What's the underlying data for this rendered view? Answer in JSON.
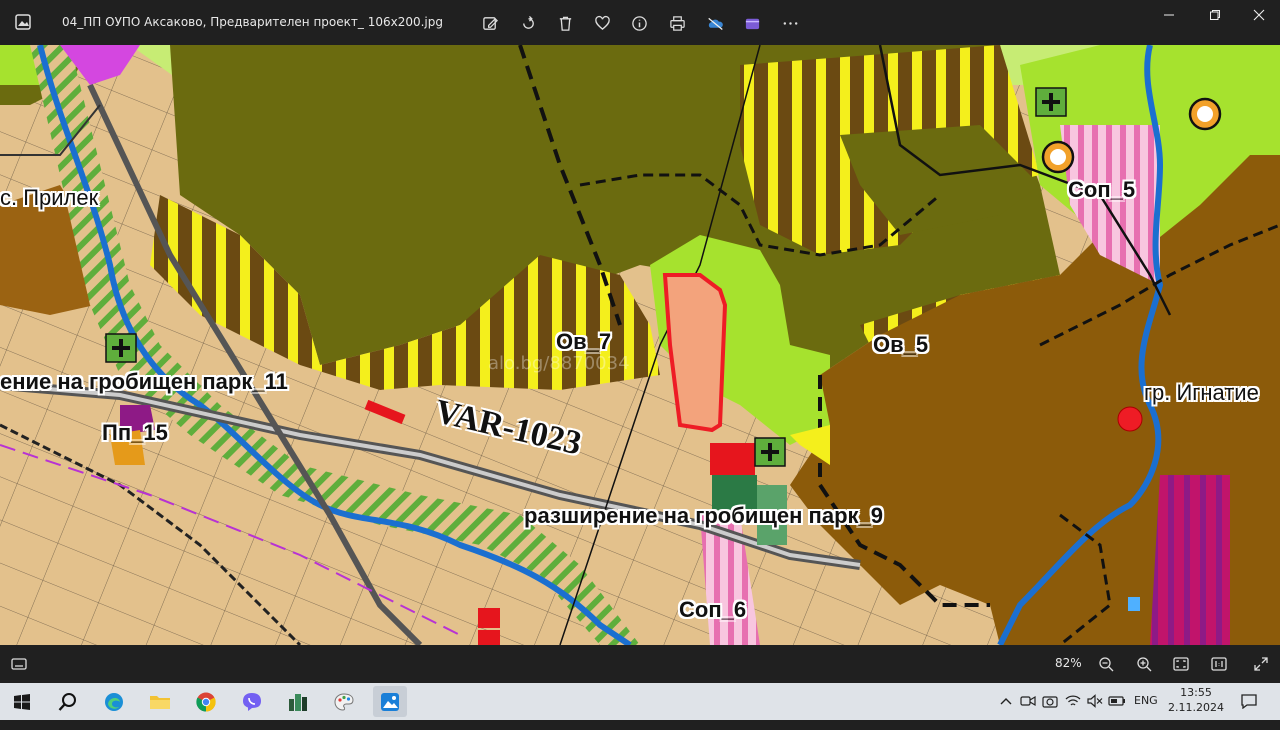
{
  "window": {
    "title": "04_ПП ОУПО Аксаково, Предварителен проект_ 106x200.jpg"
  },
  "toolbar": {
    "icons": [
      "edit-icon",
      "rotate-icon",
      "delete-icon",
      "favorite-icon",
      "info-icon",
      "print-icon",
      "onedrive-icon",
      "clipchamp-icon",
      "more-icon"
    ]
  },
  "map": {
    "labels": {
      "prilek": "с. Прилек",
      "ext11": "ение на гробищен парк_11",
      "pp15": "Пп_15",
      "ov7": "Ов_7",
      "ov5": "Ов_5",
      "sop5": "Соп_5",
      "ignatievo": "гр. Игнатие",
      "ext9": "разширение на гробищен парк_9",
      "sop6": "Соп_6",
      "road": "VAR-1023",
      "watermark": "alo.bg/8870034"
    }
  },
  "status": {
    "zoom": "82%"
  },
  "taskbar": {
    "lang": "ENG",
    "time": "13:55",
    "date": "2.11.2024 г."
  }
}
